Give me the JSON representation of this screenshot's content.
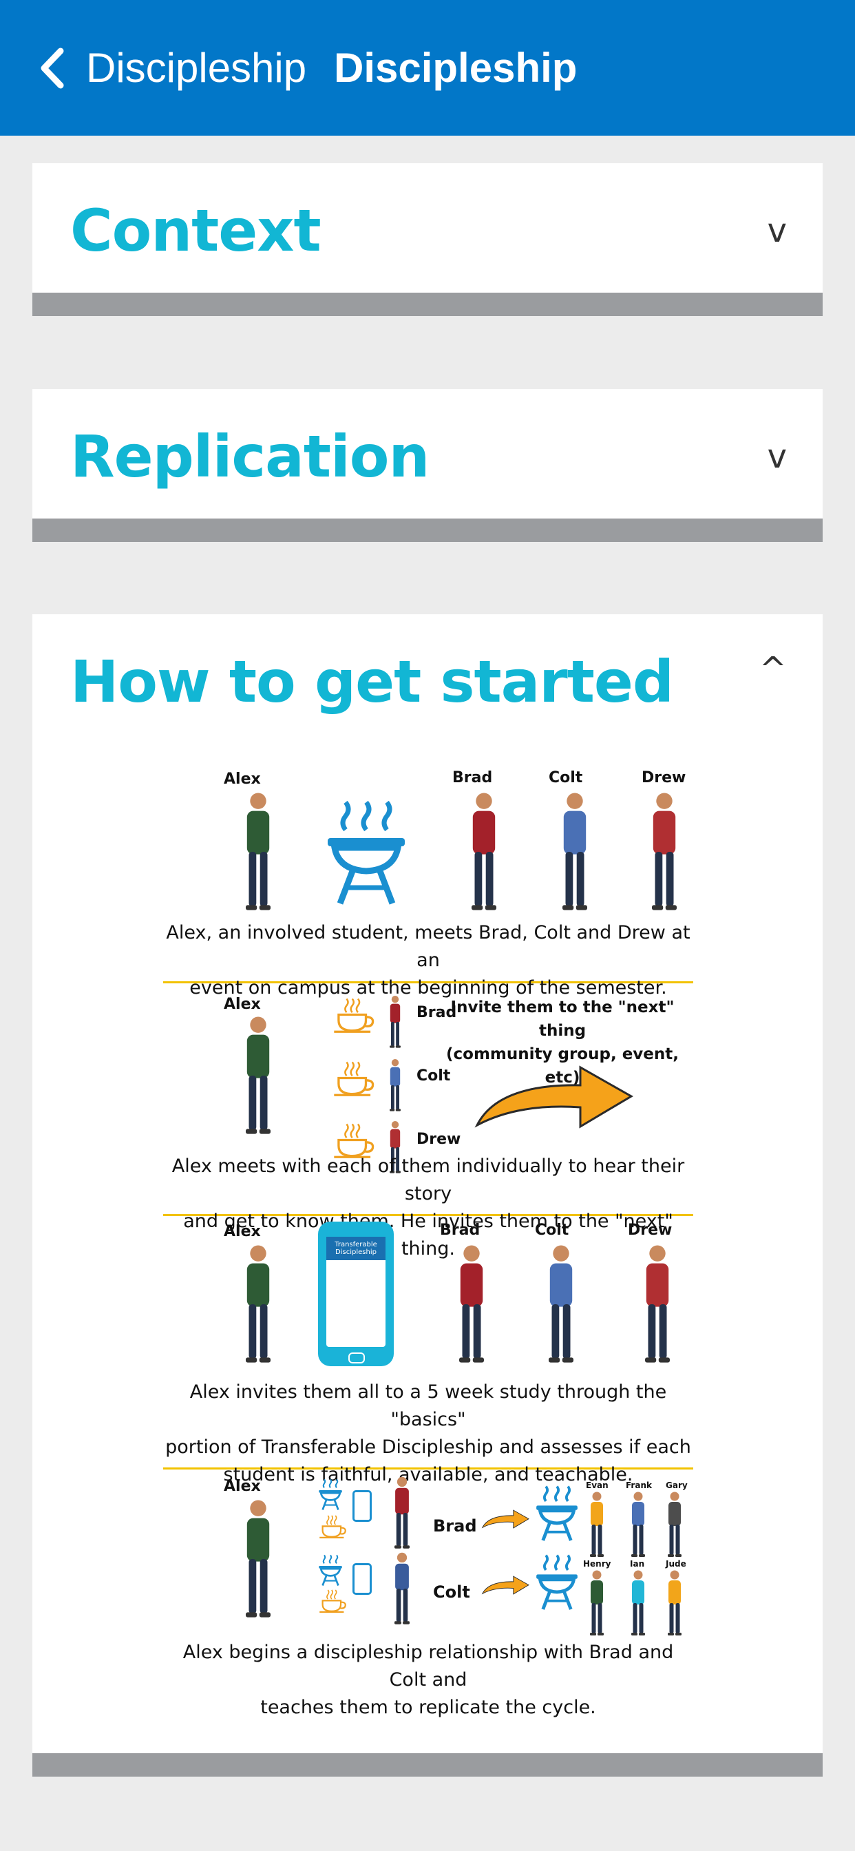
{
  "header": {
    "back_label": "Discipleship",
    "title": "Discipleship"
  },
  "sections": [
    {
      "title": "Context",
      "toggle": "v",
      "expanded": false
    },
    {
      "title": "Replication",
      "toggle": "v",
      "expanded": false
    },
    {
      "title": "How to get started",
      "toggle": "^",
      "expanded": true
    }
  ],
  "infographic": {
    "panel1": {
      "names": [
        "Alex",
        "Brad",
        "Colt",
        "Drew"
      ],
      "caption_line1": "Alex, an involved student, meets Brad, Colt and Drew at an",
      "caption_line2": "event on campus at the beginning of the semester."
    },
    "panel2": {
      "names": [
        "Alex",
        "Brad",
        "Colt",
        "Drew"
      ],
      "invite_line1": "Invite them to the \"next\" thing",
      "invite_line2": "(community group, event, etc)",
      "caption_line1": "Alex meets with each of them individually to hear their story",
      "caption_line2": "and get to know them. He invites them to the \"next\" thing."
    },
    "panel3": {
      "names": [
        "Alex",
        "Brad",
        "Colt",
        "Drew"
      ],
      "phone_text_1": "Transferable",
      "phone_text_2": "Discipleship",
      "caption_line1": "Alex invites them all to a 5 week study through the \"basics\"",
      "caption_line2": "portion of Transferable Discipleship and assesses if each",
      "caption_line3": "student is faithful, available, and teachable."
    },
    "panel4": {
      "names": [
        "Alex",
        "Brad",
        "Colt"
      ],
      "small_names": [
        "Evan",
        "Frank",
        "Gary",
        "Henry",
        "Ian",
        "Jude"
      ],
      "caption_line1": "Alex begins a discipleship relationship with Brad and Colt and",
      "caption_line2": "teaches them to replicate the cycle."
    }
  },
  "colors": {
    "header_bg": "#0277c8",
    "section_title": "#12b6d4",
    "card_bar": "#9a9c9f",
    "divider": "#f2c200",
    "grill_blue": "#1a8fd0",
    "cup_orange": "#f0a020"
  },
  "icons": [
    "back-chevron-icon",
    "grill-icon",
    "coffee-cup-icon",
    "arrow-icon",
    "phone-icon",
    "person-icon"
  ]
}
